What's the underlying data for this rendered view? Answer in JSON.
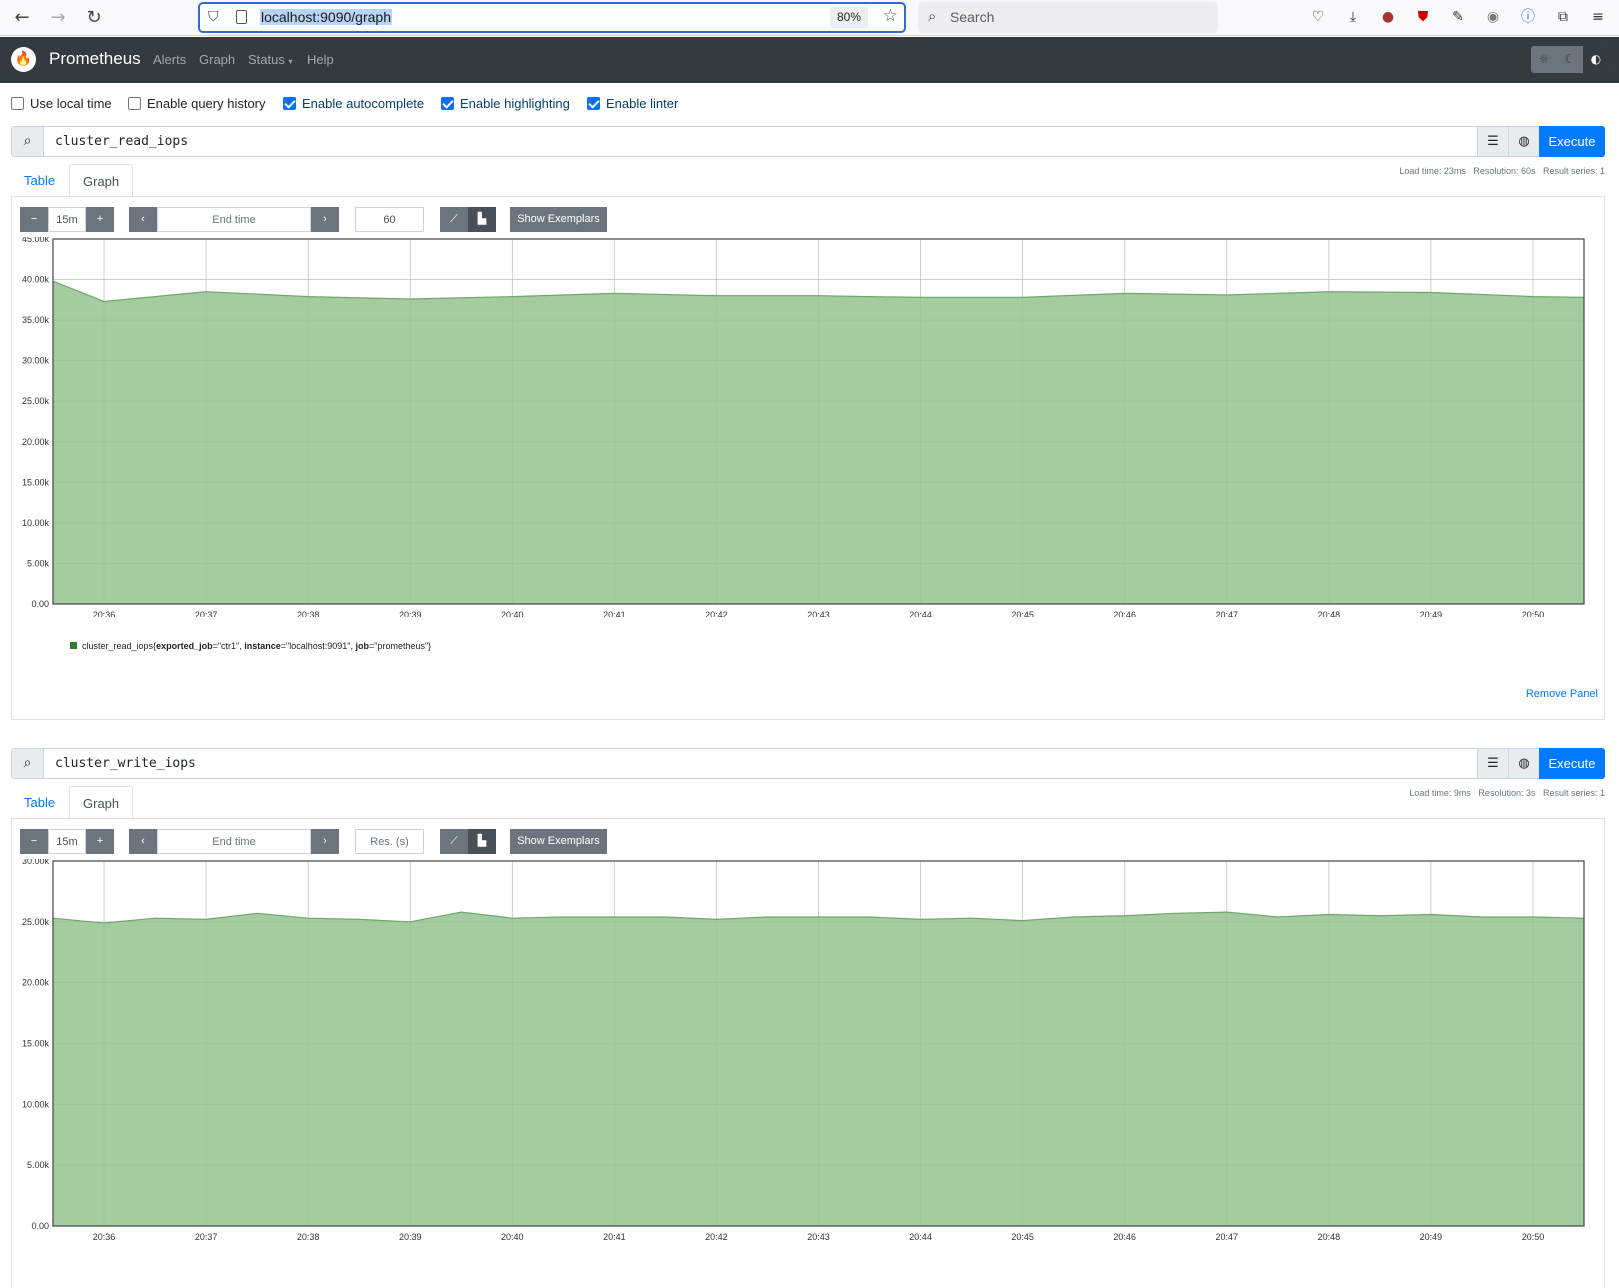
{
  "browser": {
    "url": "localhost:9090/graph",
    "zoom": "80%",
    "search_placeholder": "Search"
  },
  "navbar": {
    "brand": "Prometheus",
    "links": [
      "Alerts",
      "Graph",
      "Status",
      "Help"
    ]
  },
  "options": [
    {
      "label": "Use local time",
      "checked": false
    },
    {
      "label": "Enable query history",
      "checked": false
    },
    {
      "label": "Enable autocomplete",
      "checked": true
    },
    {
      "label": "Enable highlighting",
      "checked": true
    },
    {
      "label": "Enable linter",
      "checked": true
    }
  ],
  "panels": [
    {
      "expression": "cluster_read_iops",
      "execute_label": "Execute",
      "stats": "Load time: 23ms   Resolution: 60s   Result series: 1",
      "tabs": [
        "Table",
        "Graph"
      ],
      "active_tab": "Graph",
      "range": "15m",
      "end_time_placeholder": "End time",
      "resolution": "60",
      "exemplars_label": "Show Exemplars",
      "legend": {
        "metric": "cluster_read_iops",
        "labels_text": "{exported_job=\"ctr1\", instance=\"localhost:9091\", job=\"prometheus\"}"
      },
      "remove_label": "Remove Panel"
    },
    {
      "expression": "cluster_write_iops",
      "execute_label": "Execute",
      "stats": "Load time: 9ms   Resolution: 3s   Result series: 1",
      "tabs": [
        "Table",
        "Graph"
      ],
      "active_tab": "Graph",
      "range": "15m",
      "end_time_placeholder": "End time",
      "resolution_placeholder": "Res. (s)",
      "exemplars_label": "Show Exemplars"
    }
  ],
  "chart_data": [
    {
      "type": "area",
      "series": [
        {
          "name": "cluster_read_iops{exported_job=\"ctr1\", instance=\"localhost:9091\", job=\"prometheus\"}",
          "x": [
            "20:35:30",
            "20:36",
            "20:37",
            "20:38",
            "20:39",
            "20:40",
            "20:41",
            "20:42",
            "20:43",
            "20:44",
            "20:45",
            "20:46",
            "20:47",
            "20:48",
            "20:49",
            "20:50",
            "20:50:30"
          ],
          "values": [
            39800,
            37300,
            38500,
            37900,
            37600,
            37900,
            38300,
            38000,
            38000,
            37800,
            37800,
            38300,
            38100,
            38500,
            38400,
            37900,
            37800
          ]
        }
      ],
      "xticks": [
        "20:36",
        "20:37",
        "20:38",
        "20:39",
        "20:40",
        "20:41",
        "20:42",
        "20:43",
        "20:44",
        "20:45",
        "20:46",
        "20:47",
        "20:48",
        "20:49",
        "20:50"
      ],
      "yticks": [
        "0.00",
        "5.00k",
        "10.00k",
        "15.00k",
        "20.00k",
        "25.00k",
        "30.00k",
        "35.00k",
        "40.00k",
        "45.00k"
      ],
      "ylim": [
        0,
        45000
      ],
      "color": "#a5cba0",
      "line_color": "#6fa86a",
      "grid": true
    },
    {
      "type": "area",
      "series": [
        {
          "name": "cluster_write_iops",
          "x": [
            "20:35:30",
            "20:36",
            "20:36:30",
            "20:37",
            "20:37:30",
            "20:38",
            "20:38:30",
            "20:39",
            "20:39:30",
            "20:40",
            "20:40:30",
            "20:41",
            "20:41:30",
            "20:42",
            "20:42:30",
            "20:43",
            "20:43:30",
            "20:44",
            "20:44:30",
            "20:45",
            "20:45:30",
            "20:46",
            "20:46:30",
            "20:47",
            "20:47:30",
            "20:48",
            "20:48:30",
            "20:49",
            "20:49:30",
            "20:50",
            "20:50:30"
          ],
          "values": [
            25300,
            24900,
            25300,
            25200,
            25700,
            25300,
            25200,
            25000,
            25800,
            25300,
            25400,
            25400,
            25400,
            25200,
            25400,
            25400,
            25400,
            25200,
            25300,
            25100,
            25400,
            25500,
            25700,
            25800,
            25400,
            25600,
            25500,
            25600,
            25400,
            25400,
            25300
          ]
        }
      ],
      "xticks": [
        "20:36",
        "20:37",
        "20:38",
        "20:39",
        "20:40",
        "20:41",
        "20:42",
        "20:43",
        "20:44",
        "20:45",
        "20:46",
        "20:47",
        "20:48",
        "20:49",
        "20:50"
      ],
      "yticks": [
        "0.00",
        "5.00k",
        "10.00k",
        "15.00k",
        "20.00k",
        "25.00k",
        "30.00k"
      ],
      "ylim": [
        0,
        30000
      ],
      "color": "#a5cba0",
      "line_color": "#6fa86a",
      "grid": true
    }
  ]
}
